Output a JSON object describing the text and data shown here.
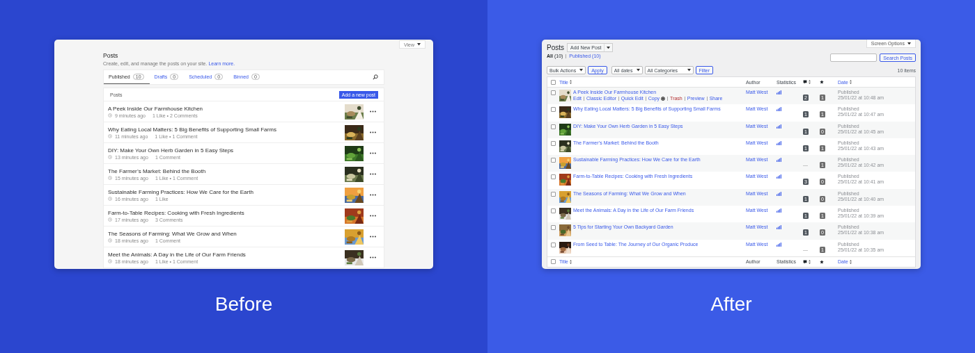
{
  "before": {
    "caption": "Before",
    "view_button": "View",
    "title": "Posts",
    "description": "Create, edit, and manage the posts on your site.",
    "learn_more": "Learn more.",
    "tabs": [
      {
        "label": "Published",
        "count": "10",
        "selected": true
      },
      {
        "label": "Drafts",
        "count": "0",
        "selected": false
      },
      {
        "label": "Scheduled",
        "count": "0",
        "selected": false
      },
      {
        "label": "Binned",
        "count": "0",
        "selected": false
      }
    ],
    "list_header": "Posts",
    "add_button": "Add a new post",
    "posts": [
      {
        "title": "A Peek Inside Our Farmhouse Kitchen",
        "time": "9 minutes ago",
        "stats": "1 Like • 2 Comments"
      },
      {
        "title": "Why Eating Local Matters: 5 Big Benefits of Supporting Small Farms",
        "time": "11 minutes ago",
        "stats": "1 Like • 1 Comment"
      },
      {
        "title": "DIY: Make Your Own Herb Garden in 5 Easy Steps",
        "time": "13 minutes ago",
        "stats": "1 Comment"
      },
      {
        "title": "The Farmer’s Market: Behind the Booth",
        "time": "15 minutes ago",
        "stats": "1 Like • 1 Comment"
      },
      {
        "title": "Sustainable Farming Practices: How We Care for the Earth",
        "time": "16 minutes ago",
        "stats": "1 Like"
      },
      {
        "title": "Farm-to-Table Recipes: Cooking with Fresh Ingredients",
        "time": "17 minutes ago",
        "stats": "3 Comments"
      },
      {
        "title": "The Seasons of Farming: What We Grow and When",
        "time": "18 minutes ago",
        "stats": "1 Comment"
      },
      {
        "title": "Meet the Animals: A Day in the Life of Our Farm Friends",
        "time": "18 minutes ago",
        "stats": "1 Like • 1 Comment"
      }
    ]
  },
  "after": {
    "caption": "After",
    "screen_options": "Screen Options",
    "title": "Posts",
    "add_new": "Add New Post",
    "views": [
      {
        "label": "All",
        "count": "(10)",
        "selected": true
      },
      {
        "label": "Published",
        "count": "(10)",
        "selected": false
      }
    ],
    "bulk_actions": "Bulk Actions",
    "apply": "Apply",
    "dates": "All dates",
    "categories": "All Categories",
    "filter": "Filter",
    "search_button": "Search Posts",
    "items_count": "10 items",
    "columns": {
      "checked": false,
      "title": "Title",
      "author": "Author",
      "statistics": "Statistics",
      "date": "Date"
    },
    "footer_columns": {
      "checked": false,
      "title": "Title",
      "author": "Author",
      "statistics": "Statistics",
      "date": "Date"
    },
    "rows": [
      {
        "checked": false,
        "title": "A Peek Inside Our Farmhouse Kitchen",
        "author": "Matt West",
        "comments": {
          "kind": "bubble",
          "text": "2"
        },
        "likes": "1",
        "status": "Published",
        "date": "25/01/22 at 10:48 am",
        "row_actions": [
          {
            "label": "Edit",
            "kind": "link"
          },
          {
            "label": "Classic Editor",
            "kind": "link"
          },
          {
            "label": "Quick Edit",
            "kind": "link"
          },
          {
            "label": "Copy",
            "kind": "copy"
          },
          {
            "label": "Trash",
            "kind": "danger"
          },
          {
            "label": "Preview",
            "kind": "link"
          },
          {
            "label": "Share",
            "kind": "link"
          }
        ]
      },
      {
        "checked": false,
        "title": "Why Eating Local Matters: 5 Big Benefits of Supporting Small Farms",
        "author": "Matt West",
        "comments": {
          "kind": "bubble",
          "text": "1"
        },
        "likes": "1",
        "status": "Published",
        "date": "25/01/22 at 10:47 am"
      },
      {
        "checked": false,
        "title": "DIY: Make Your Own Herb Garden in 5 Easy Steps",
        "author": "Matt West",
        "comments": {
          "kind": "bubble",
          "text": "1"
        },
        "likes": "0",
        "status": "Published",
        "date": "25/01/22 at 10:45 am"
      },
      {
        "checked": false,
        "title": "The Farmer’s Market: Behind the Booth",
        "author": "Matt West",
        "comments": {
          "kind": "bubble",
          "text": "1"
        },
        "likes": "1",
        "status": "Published",
        "date": "25/01/22 at 10:43 am"
      },
      {
        "checked": false,
        "title": "Sustainable Farming Practices: How We Care for the Earth",
        "author": "Matt West",
        "comments": {
          "kind": "none",
          "text": "—"
        },
        "likes": "1",
        "status": "Published",
        "date": "25/01/22 at 10:42 am"
      },
      {
        "checked": false,
        "title": "Farm-to-Table Recipes: Cooking with Fresh Ingredients",
        "author": "Matt West",
        "comments": {
          "kind": "bubble",
          "text": "3"
        },
        "likes": "0",
        "status": "Published",
        "date": "25/01/22 at 10:41 am"
      },
      {
        "checked": false,
        "title": "The Seasons of Farming: What We Grow and When",
        "author": "Matt West",
        "comments": {
          "kind": "bubble",
          "text": "1"
        },
        "likes": "0",
        "status": "Published",
        "date": "25/01/22 at 10:40 am"
      },
      {
        "checked": false,
        "title": "Meet the Animals: A Day in the Life of Our Farm Friends",
        "author": "Matt West",
        "comments": {
          "kind": "bubble",
          "text": "1"
        },
        "likes": "1",
        "status": "Published",
        "date": "25/01/22 at 10:39 am"
      },
      {
        "checked": false,
        "title": "5 Tips for Starting Your Own Backyard Garden",
        "author": "Matt West",
        "comments": {
          "kind": "bubble",
          "text": "1"
        },
        "likes": "0",
        "status": "Published",
        "date": "25/01/22 at 10:38 am"
      },
      {
        "checked": false,
        "title": "From Seed to Table: The Journey of Our Organic Produce",
        "author": "Matt West",
        "comments": {
          "kind": "none",
          "text": "—"
        },
        "likes": "1",
        "status": "Published",
        "date": "25/01/22 at 10:35 am"
      }
    ]
  }
}
